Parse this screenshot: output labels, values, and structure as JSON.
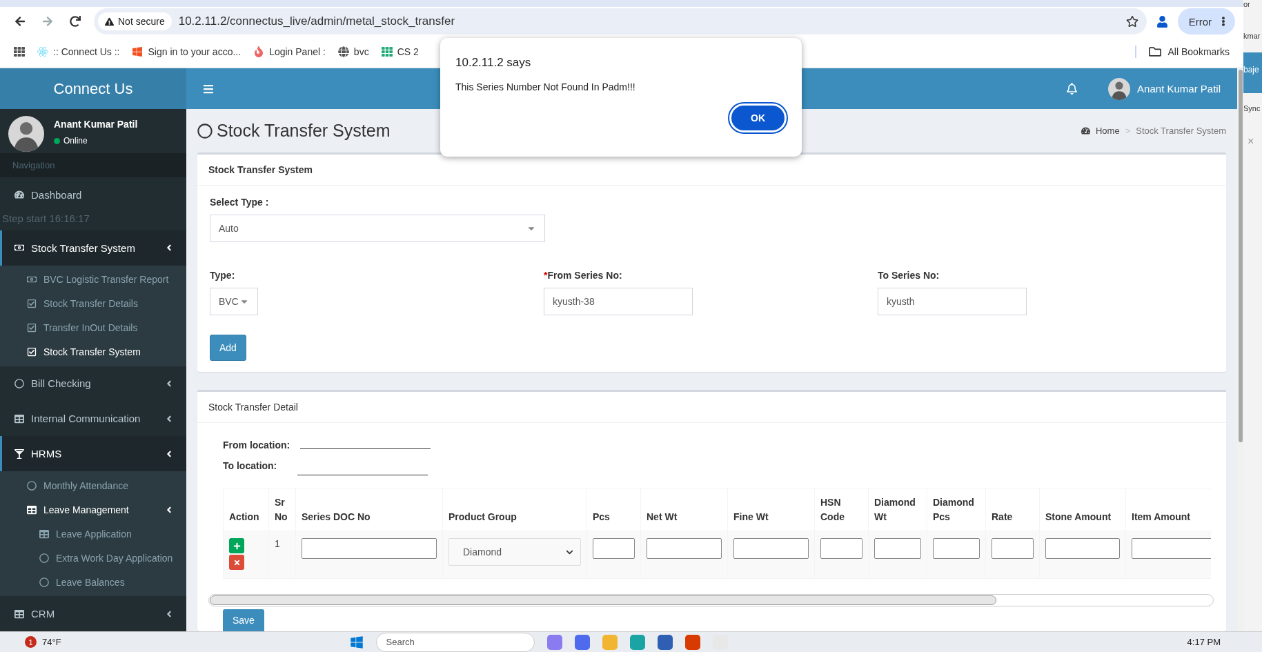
{
  "browser": {
    "security": "Not secure",
    "url": "10.2.11.2/connectus_live/admin/metal_stock_transfer",
    "profile_button": "Error",
    "all_bookmarks": "All Bookmarks",
    "bookmarks": [
      {
        "label": ":: Connect Us ::",
        "kind": "atom"
      },
      {
        "label": "Sign in to your acco...",
        "kind": "windows"
      },
      {
        "label": "Login Panel :",
        "kind": "flame"
      },
      {
        "label": "bvc",
        "kind": "globe"
      },
      {
        "label": "CS 2",
        "kind": "tile"
      }
    ]
  },
  "app": {
    "brand": "Connect Us",
    "header_user": "Anant Kumar Patil",
    "user_name": "Anant Kumar Patil",
    "status": "Online",
    "nav_label": "Navigation"
  },
  "sidebar": {
    "items": [
      {
        "label": "Dashboard",
        "kind": "link",
        "selected": false
      },
      {
        "label": "Step start 16:16:17",
        "kind": "note"
      },
      {
        "label": "Stock Transfer System",
        "kind": "group",
        "selected": true,
        "children": [
          {
            "label": "BVC Logistic Transfer Report",
            "selected": false
          },
          {
            "label": "Stock Transfer Details",
            "selected": false
          },
          {
            "label": "Transfer InOut Details",
            "selected": false
          },
          {
            "label": "Stock Transfer System",
            "selected": true
          }
        ]
      },
      {
        "label": "Bill Checking",
        "kind": "group",
        "selected": false
      },
      {
        "label": "Internal Communication",
        "kind": "group",
        "selected": false
      },
      {
        "label": "HRMS",
        "kind": "group",
        "selected": true,
        "children": [
          {
            "label": "Monthly Attendance",
            "kind": "link",
            "selected": false
          },
          {
            "label": "Leave Management",
            "kind": "group",
            "selected": true,
            "children": [
              {
                "label": "Leave Application",
                "selected": false
              },
              {
                "label": "Extra Work Day Application",
                "selected": false
              },
              {
                "label": "Leave Balances",
                "selected": false
              }
            ]
          }
        ]
      },
      {
        "label": "CRM",
        "kind": "group",
        "selected": false
      }
    ]
  },
  "page": {
    "title": "Stock Transfer System",
    "breadcrumb": [
      "Home",
      "Stock Transfer System"
    ],
    "breadcrumb_separator": ">"
  },
  "form": {
    "title": "Stock Transfer System",
    "select_type_label": "Select Type :",
    "select_type_value": "Auto",
    "type_label": "Type:",
    "type_value": "BVC",
    "required_mark": "*",
    "from_label": "From Series No:",
    "from_value": "kyusth-38",
    "to_label": "To Series No:",
    "to_value": "kyusth",
    "add_button": "Add"
  },
  "detail": {
    "title": "Stock Transfer Detail",
    "from_location_label": "From location:",
    "to_location_label": "To location:",
    "columns": [
      "Action",
      "Sr No",
      "Series DOC No",
      "Product Group",
      "Pcs",
      "Net Wt",
      "Fine Wt",
      "HSN Code",
      "Diamond Wt",
      "Diamond Pcs",
      "Rate",
      "Stone Amount",
      "Item Amount"
    ],
    "rows": [
      {
        "sr": "1",
        "product_group": "Diamond"
      }
    ],
    "save_button": "Save"
  },
  "dialog": {
    "title": "10.2.11.2 says",
    "message": "This Series Number Not Found In Padm!!!",
    "ok_button": "OK"
  },
  "side_window": {
    "texts": [
      "or",
      "kmar",
      "baje",
      "Sync",
      "×"
    ]
  },
  "taskbar": {
    "weather_badge": "1",
    "temperature": "74°F",
    "search_placeholder": "Search",
    "time": "4:17 PM"
  }
}
